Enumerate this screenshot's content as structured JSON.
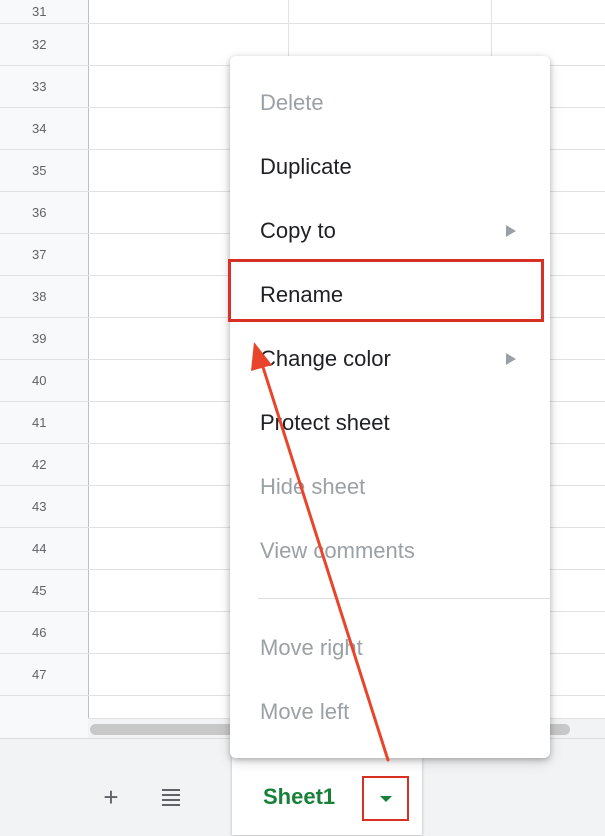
{
  "grid": {
    "row_numbers": [
      "31",
      "32",
      "33",
      "34",
      "35",
      "36",
      "37",
      "38",
      "39",
      "40",
      "41",
      "42",
      "43",
      "44",
      "45",
      "46",
      "47"
    ]
  },
  "context_menu": {
    "items": [
      {
        "label": "Delete",
        "enabled": false,
        "has_submenu": false
      },
      {
        "label": "Duplicate",
        "enabled": true,
        "has_submenu": false
      },
      {
        "label": "Copy to",
        "enabled": true,
        "has_submenu": true
      },
      {
        "label": "Rename",
        "enabled": true,
        "has_submenu": false,
        "highlighted": true
      },
      {
        "label": "Change color",
        "enabled": true,
        "has_submenu": true
      },
      {
        "label": "Protect sheet",
        "enabled": true,
        "has_submenu": false
      },
      {
        "label": "Hide sheet",
        "enabled": false,
        "has_submenu": false
      },
      {
        "label": "View comments",
        "enabled": false,
        "has_submenu": false
      },
      {
        "label": "Move right",
        "enabled": false,
        "has_submenu": false
      },
      {
        "label": "Move left",
        "enabled": false,
        "has_submenu": false
      }
    ]
  },
  "sheet_bar": {
    "add_icon": "plus-icon",
    "all_sheets_icon": "list-icon",
    "active_sheet": "Sheet1",
    "dropdown_icon": "triangle-down-icon"
  },
  "colors": {
    "active_sheet_text": "#188038",
    "highlight_box": "#d93025",
    "annotation_arrow": "#e8452c",
    "disabled_text": "#9aa0a6"
  }
}
